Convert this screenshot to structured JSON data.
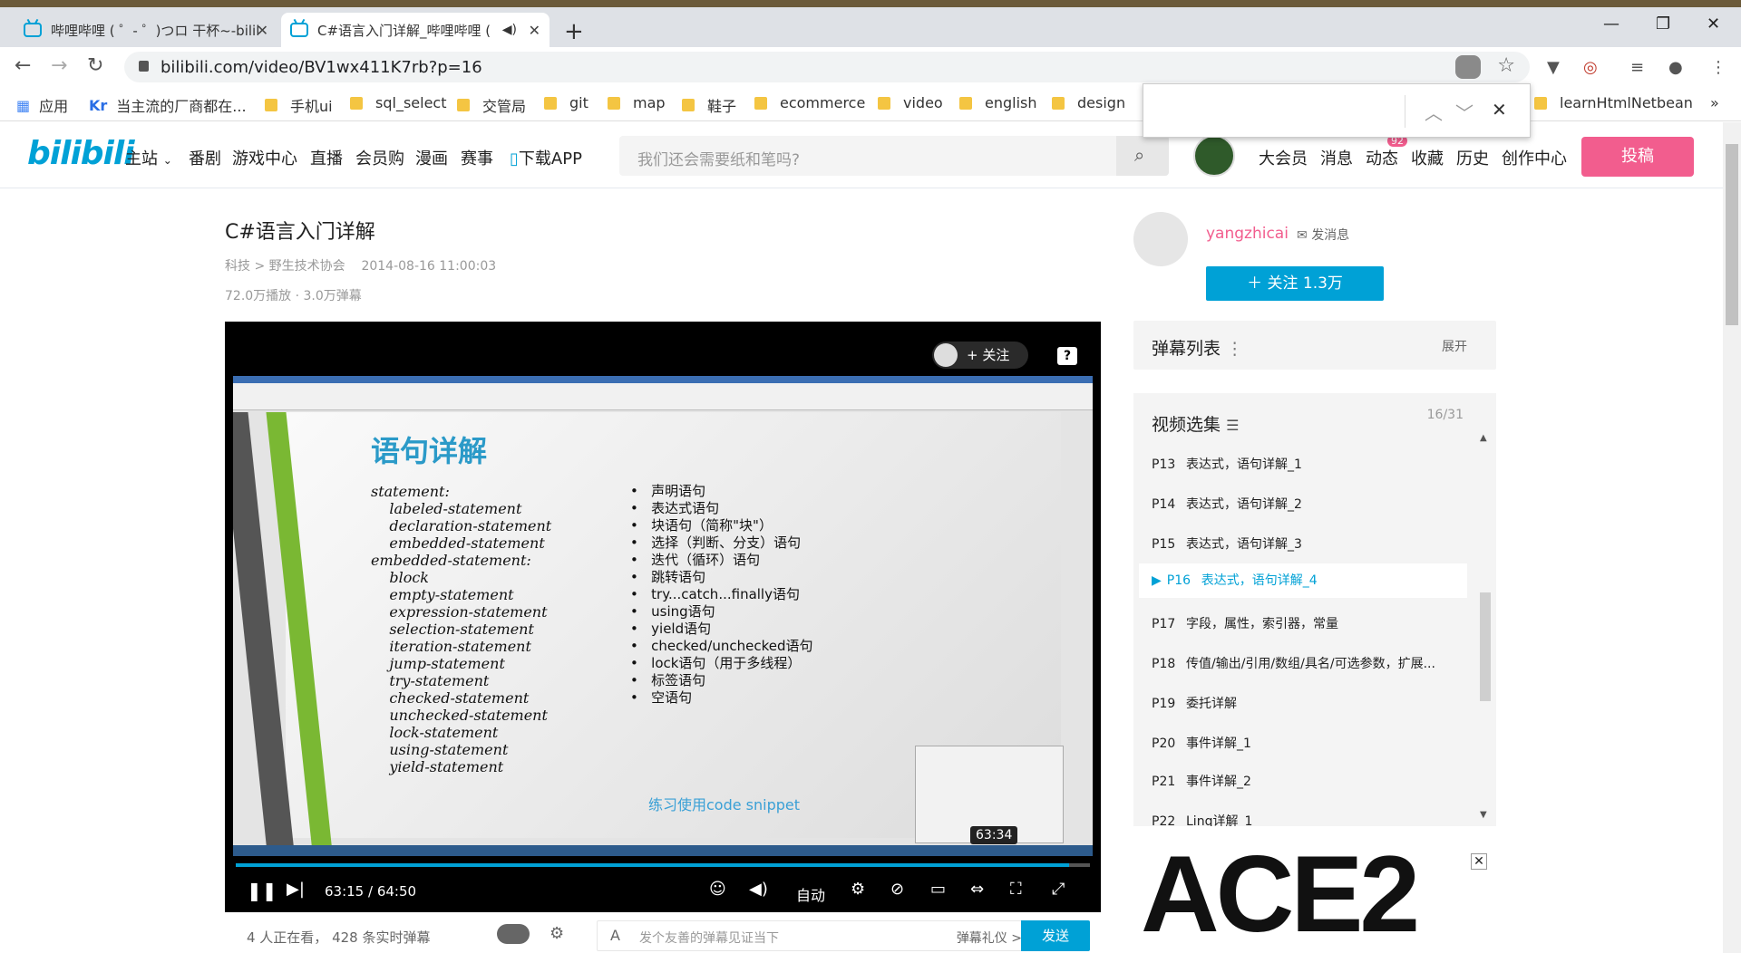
{
  "browser": {
    "tabs": [
      {
        "title": "哔哩哔哩 ( ゜- ゜)つロ 干杯~-bilil"
      },
      {
        "title": "C#语言入门详解_哔哩哔哩 ("
      }
    ],
    "url": "bilibili.com/video/BV1wx411K7rb?p=16",
    "bookmarks": [
      "应用",
      "当主流的厂商都在...",
      "手机ui",
      "sql_select",
      "交管局",
      "git",
      "map",
      "鞋子",
      "ecommerce",
      "video",
      "english",
      "design",
      "learnHtmlNetbean"
    ]
  },
  "header": {
    "logo": "bilibili",
    "nav": [
      "主站",
      "番剧",
      "游戏中心",
      "直播",
      "会员购",
      "漫画",
      "赛事",
      "下载APP"
    ],
    "search_placeholder": "我们还会需要纸和笔吗?",
    "right_nav": [
      "大会员",
      "消息",
      "动态",
      "收藏",
      "历史",
      "创作中心"
    ],
    "dynamic_badge": "92",
    "post_label": "投稿"
  },
  "video": {
    "title": "C#语言入门详解",
    "category": "科技 > 野生技术协会",
    "date": "2014-08-16 11:00:03",
    "stats": "72.0万播放 · 3.0万弹幕",
    "follow_label": "+ 关注",
    "current_time": "63:15 / 64:50",
    "progress_fraction": 0.976,
    "hover_time": "63:34",
    "quality": "自动",
    "viewers": "4 人正在看， 428 条实时弹幕",
    "danmaku_placeholder": "发个友善的弹幕见证当下",
    "danmaku_gift": "弹幕礼仪 >",
    "send_label": "发送"
  },
  "slide": {
    "title": "语句详解",
    "statements": "statement:\n    labeled-statement\n    declaration-statement\n    embedded-statement\nembedded-statement:\n    block\n    empty-statement\n    expression-statement\n    selection-statement\n    iteration-statement\n    jump-statement\n    try-statement\n    checked-statement\n    unchecked-statement\n    lock-statement\n    using-statement\n    yield-statement",
    "bullets": "•   声明语句\n•   表达式语句\n•   块语句（简称\"块\"）\n•   选择（判断、分支）语句\n•   迭代（循环）语句\n•   跳转语句\n•   try...catch...finally语句\n•   using语句\n•   yield语句\n•   checked/unchecked语句\n•   lock语句（用于多线程）\n•   标签语句\n•   空语句",
    "snippet": "练习使用code snippet"
  },
  "uploader": {
    "name": "yangzhicai",
    "send_msg": "发消息",
    "follow": "关注 1.3万"
  },
  "danmaku_list": {
    "title": "弹幕列表",
    "expand": "展开"
  },
  "episodes": {
    "title": "视频选集",
    "count": "16/31",
    "items": [
      {
        "p": "P13",
        "name": "表达式，语句详解_1"
      },
      {
        "p": "P14",
        "name": "表达式，语句详解_2"
      },
      {
        "p": "P15",
        "name": "表达式，语句详解_3"
      },
      {
        "p": "P16",
        "name": "表达式，语句详解_4"
      },
      {
        "p": "P17",
        "name": "字段，属性，索引器，常量"
      },
      {
        "p": "P18",
        "name": "传值/输出/引用/数组/具名/可选参数，扩展..."
      },
      {
        "p": "P19",
        "name": "委托详解"
      },
      {
        "p": "P20",
        "name": "事件详解_1"
      },
      {
        "p": "P21",
        "name": "事件详解_2"
      },
      {
        "p": "P22",
        "name": "Linq详解_1"
      }
    ]
  },
  "ad": {
    "text": "ACE2"
  }
}
